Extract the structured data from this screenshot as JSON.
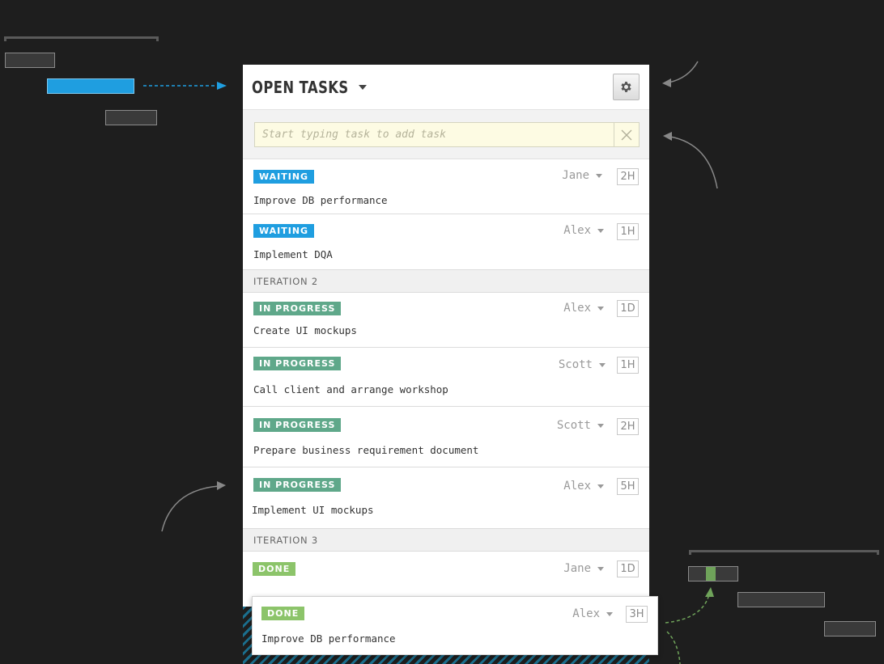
{
  "panel": {
    "title": "OPEN TASKS",
    "settings_icon": "gear-icon",
    "search": {
      "placeholder": "Start typing task to add task",
      "value": ""
    },
    "clear_icon": "close-icon"
  },
  "tasks": [
    {
      "status": "WAITING",
      "assignee": "Jane",
      "estimate": "2H",
      "name": "Improve DB performance"
    },
    {
      "status": "WAITING",
      "assignee": "Alex",
      "estimate": "1H",
      "name": "Implement DQA"
    }
  ],
  "groups": [
    {
      "label": "ITERATION 2",
      "tasks": [
        {
          "status": "IN PROGRESS",
          "assignee": "Alex",
          "estimate": "1D",
          "name": "Create UI mockups"
        },
        {
          "status": "IN PROGRESS",
          "assignee": "Scott",
          "estimate": "1H",
          "name": "Call client and arrange workshop"
        },
        {
          "status": "IN PROGRESS",
          "assignee": "Scott",
          "estimate": "2H",
          "name": "Prepare business requirement document"
        },
        {
          "status": "IN PROGRESS",
          "assignee": "Alex",
          "estimate": "5H",
          "name": "Implement UI mockups"
        }
      ]
    },
    {
      "label": "ITERATION 3",
      "tasks": [
        {
          "status": "DONE",
          "assignee": "Jane",
          "estimate": "1D",
          "name": ""
        }
      ]
    }
  ],
  "dragged_task": {
    "status": "DONE",
    "assignee": "Alex",
    "estimate": "3H",
    "name": "Improve DB performance"
  },
  "colors": {
    "waiting": "#1f9ee0",
    "in_progress": "#5fa88a",
    "done": "#8cc46a",
    "background": "#1e1e1e"
  }
}
